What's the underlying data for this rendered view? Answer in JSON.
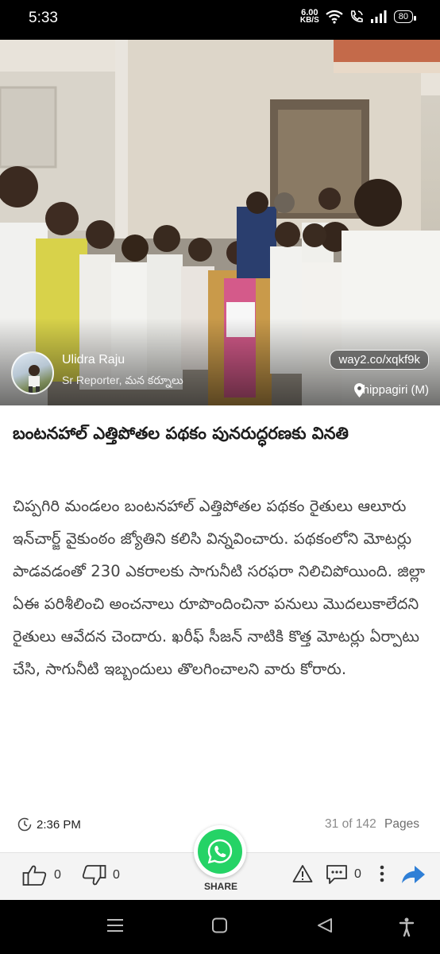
{
  "status_bar": {
    "time": "5:33",
    "net_speed_value": "6.00",
    "net_speed_unit": "KB/S",
    "battery": "80"
  },
  "article": {
    "photo_icon": "group-photo-image",
    "reporter": {
      "name": "Ulidra Raju",
      "role": "Sr Reporter, మన కర్నూలు"
    },
    "short_link": "way2.co/xqkf9k",
    "location": "Chippagiri (M)",
    "headline": "బంటనహాల్ ఎత్తిపోతల పథకం పునరుద్ధరణకు వినతి",
    "body": "చిప్పగిరి మండలం బంటనహాల్ ఎత్తిపోతల పథకం రైతులు ఆలూరు ఇన్‌చార్జ్ వైకుంఠం జ్యోతిని కలిసి విన్నవించారు. పథకంలోని మోటర్లు పాడవడంతో 230 ఎకరాలకు సాగునీటి సరఫరా నిలిచిపోయింది. జిల్లా ఏఈ పరిశీలించి అంచనాలు రూపొందించినా పనులు మొదలుకాలేదని రైతులు ఆవేదన చెందారు. ఖరీఫ్ సీజన్ నాటికి కొత్త మోటర్లు ఏర్పాటు చేసి, సాగునీటి ఇబ్బందులు తొలగించాలని వారు కోరారు.",
    "time": "2:36 PM",
    "page_current": "31",
    "page_of": "of",
    "page_total": "142",
    "pages_label": "Pages"
  },
  "actions": {
    "like_count": "0",
    "dislike_count": "0",
    "share_label": "SHARE",
    "comment_count": "0"
  },
  "colors": {
    "whatsapp_green": "#25d366",
    "share_blue": "#2f7fd6"
  }
}
